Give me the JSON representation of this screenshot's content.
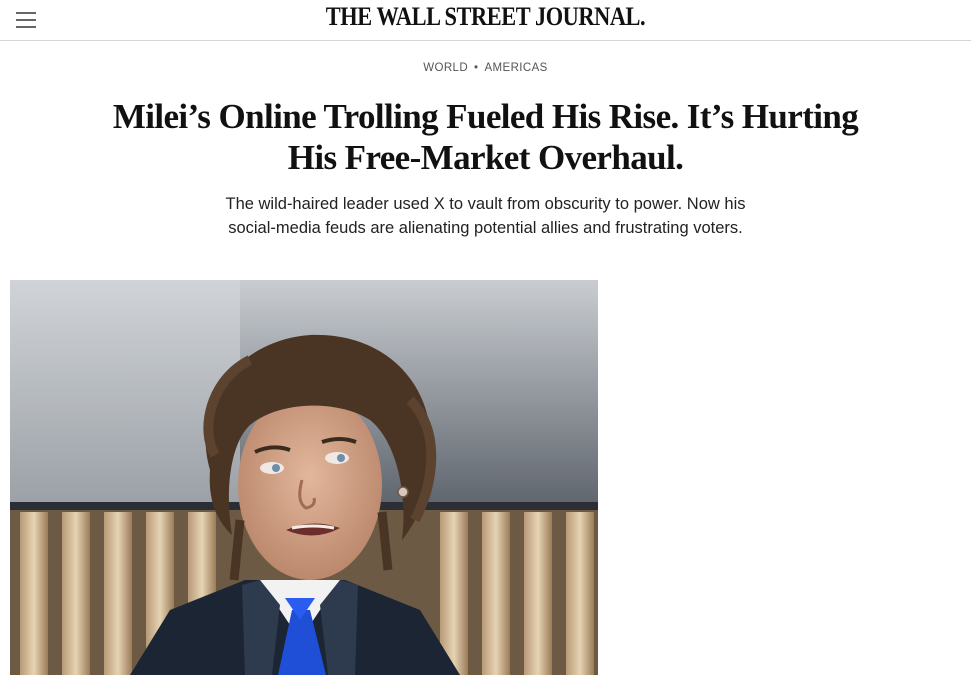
{
  "header": {
    "logo": "THE WALL STREET JOURNAL.",
    "menu_icon": "hamburger-menu-icon"
  },
  "article": {
    "breadcrumb": {
      "section": "WORLD",
      "subsection": "AMERICAS"
    },
    "headline": "Milei’s Online Trolling Fueled His Rise. It’s Hurting His Free-Market Overhaul.",
    "dek": "The wild-haired leader used X to vault from obscurity to power. Now his social-media feuds are alienating potential allies and frustrating voters."
  }
}
